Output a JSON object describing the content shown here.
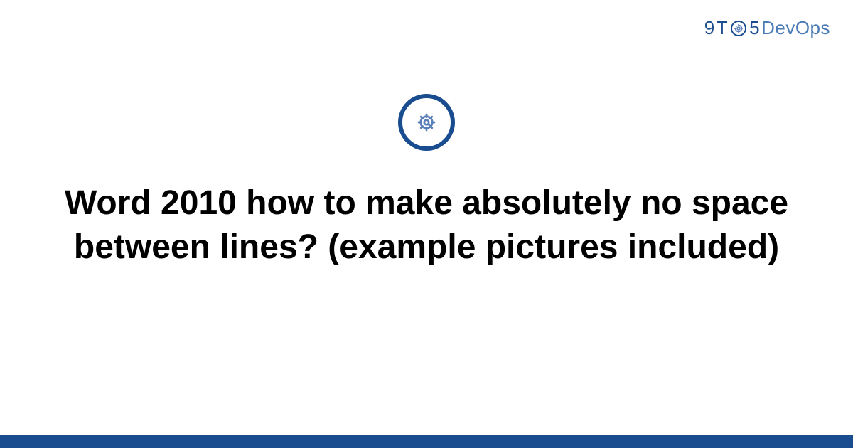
{
  "brand": {
    "part1": "9",
    "part2": "T",
    "part3": "5",
    "part4": "DevOps",
    "icon_name": "gear-icon"
  },
  "center_icon": {
    "name": "gear-icon"
  },
  "title": "Word 2010 how to make absolutely no space between lines? (example pictures included)",
  "colors": {
    "brand_primary": "#1a4d8f",
    "brand_secondary": "#4a7bb5",
    "icon_stroke": "#5a7fb8"
  }
}
